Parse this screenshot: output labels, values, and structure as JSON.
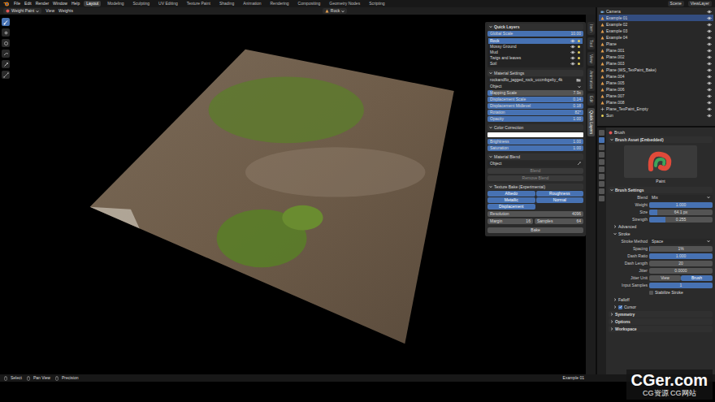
{
  "menubar": {
    "menus": [
      "File",
      "Edit",
      "Render",
      "Window",
      "Help"
    ],
    "workspaces": [
      {
        "label": "Layout",
        "selected": true
      },
      {
        "label": "Modeling",
        "selected": false
      },
      {
        "label": "Sculpting",
        "selected": false
      },
      {
        "label": "UV Editing",
        "selected": false
      },
      {
        "label": "Texture Paint",
        "selected": false
      },
      {
        "label": "Shading",
        "selected": false
      },
      {
        "label": "Animation",
        "selected": false
      },
      {
        "label": "Rendering",
        "selected": false
      },
      {
        "label": "Compositing",
        "selected": false
      },
      {
        "label": "Geometry Nodes",
        "selected": false
      },
      {
        "label": "Scripting",
        "selected": false
      }
    ],
    "scene": "Scene",
    "view_layer": "ViewLayer"
  },
  "header": {
    "mode": "Weight Paint",
    "menus": [
      "View",
      "Weights"
    ],
    "object": "Rock"
  },
  "toolbar": [
    {
      "kind": "draw",
      "selected": true
    },
    {
      "kind": "blur",
      "selected": false
    },
    {
      "kind": "average",
      "selected": false
    },
    {
      "kind": "smear",
      "selected": false
    },
    {
      "kind": "sample",
      "selected": false
    },
    {
      "kind": "gradient",
      "selected": false
    }
  ],
  "quick_layers": {
    "title": "Quick Layers",
    "global_scale": {
      "label": "Global Scale",
      "value": "10.00",
      "level": 1
    },
    "layers": [
      {
        "name": "Rock",
        "selected": true,
        "visible": true
      },
      {
        "name": "Mossy Ground",
        "selected": false,
        "visible": true
      },
      {
        "name": "Mud",
        "selected": false,
        "visible": true
      },
      {
        "name": "Twigs and leaves",
        "selected": false,
        "visible": true
      },
      {
        "name": "Soil",
        "selected": false,
        "visible": true
      }
    ],
    "material": {
      "title": "Material Settings",
      "texture": "rockandflo_jagged_rock_uccmbgelty_4k",
      "mapping": "Object",
      "sliders": [
        {
          "label": "Mapping Scale",
          "value": "7.9x",
          "level": 0.05
        },
        {
          "label": "Displacement Scale",
          "value": "0.14",
          "level": 1
        },
        {
          "label": "Displacement Midlevel",
          "value": "0.18",
          "level": 1
        },
        {
          "label": "Rotation",
          "value": "82°",
          "level": 1
        },
        {
          "label": "Opacity",
          "value": "1.00",
          "level": 1
        }
      ]
    },
    "color_correction": {
      "title": "Color Correction",
      "swatch": "#ffffff",
      "sliders": [
        {
          "label": "Brightness",
          "value": "1.00",
          "level": 1
        },
        {
          "label": "Saturation",
          "value": "1.00",
          "level": 1
        }
      ]
    },
    "blend": {
      "title": "Material Blend",
      "object": "Object",
      "buttons": [
        {
          "label": "Blend",
          "disabled": true
        },
        {
          "label": "Remove Blend",
          "disabled": true
        }
      ]
    },
    "bake": {
      "title": "Texture Bake (Experimental)",
      "maps": [
        {
          "label": "Albedo",
          "on": true
        },
        {
          "label": "Roughness",
          "on": true
        },
        {
          "label": "Metallic",
          "on": true
        },
        {
          "label": "Normal",
          "on": true
        },
        {
          "label": "Displacement",
          "on": true
        }
      ],
      "fields": [
        {
          "label": "Resolution",
          "value": "4096",
          "kind": "wide"
        },
        {
          "label": "Margin",
          "value": "16",
          "kind": "half"
        },
        {
          "label": "Samples",
          "value": "64",
          "kind": "half"
        }
      ],
      "button": "Bake"
    }
  },
  "side_tabs": [
    {
      "label": "Item",
      "selected": false
    },
    {
      "label": "Tool",
      "selected": false
    },
    {
      "label": "View",
      "selected": false
    },
    {
      "label": "Animation",
      "selected": false
    },
    {
      "label": "Edit",
      "selected": false
    },
    {
      "label": "Quick Layers",
      "selected": true
    }
  ],
  "outliner": {
    "items": [
      {
        "label": "Camera",
        "kind": "camera",
        "selected": false,
        "visible": true
      },
      {
        "label": "Example 01",
        "kind": "mesh",
        "selected": true,
        "visible": true
      },
      {
        "label": "Example 02",
        "kind": "mesh",
        "selected": false,
        "visible": true
      },
      {
        "label": "Example 03",
        "kind": "mesh",
        "selected": false,
        "visible": true
      },
      {
        "label": "Example 04",
        "kind": "mesh",
        "selected": false,
        "visible": true
      },
      {
        "label": "Plane",
        "kind": "mesh",
        "selected": false,
        "visible": true
      },
      {
        "label": "Plane.001",
        "kind": "mesh",
        "selected": false,
        "visible": true
      },
      {
        "label": "Plane.002",
        "kind": "mesh",
        "selected": false,
        "visible": true
      },
      {
        "label": "Plane.003",
        "kind": "mesh",
        "selected": false,
        "visible": true
      },
      {
        "label": "Plane (WS_TexPaint_Bake)",
        "kind": "mesh",
        "selected": false,
        "visible": true
      },
      {
        "label": "Plane.004",
        "kind": "mesh",
        "selected": false,
        "visible": true
      },
      {
        "label": "Plane.005",
        "kind": "mesh",
        "selected": false,
        "visible": true
      },
      {
        "label": "Plane.006",
        "kind": "mesh",
        "selected": false,
        "visible": true
      },
      {
        "label": "Plane.007",
        "kind": "mesh",
        "selected": false,
        "visible": true
      },
      {
        "label": "Plane.008",
        "kind": "mesh",
        "selected": false,
        "visible": true
      },
      {
        "label": "Plane_TexPaint_Empty",
        "kind": "empty",
        "selected": false,
        "visible": true
      },
      {
        "label": "Sun",
        "kind": "light",
        "selected": false,
        "visible": true
      }
    ]
  },
  "properties": {
    "title": "Brush",
    "tabs": [
      {
        "selected": false
      },
      {
        "selected": true
      },
      {
        "selected": false
      },
      {
        "selected": false
      },
      {
        "selected": false
      },
      {
        "selected": false
      },
      {
        "selected": false
      },
      {
        "selected": false
      },
      {
        "selected": false
      },
      {
        "selected": false
      }
    ],
    "rows": [
      {
        "kind": "panel",
        "label": "Brush Asset (Embedded)",
        "expanded": true
      },
      {
        "kind": "preview",
        "label": "Paint"
      },
      {
        "kind": "panel",
        "label": "Brush Settings",
        "expanded": true
      },
      {
        "kind": "dropdown",
        "label": "Blend",
        "value": "Mix"
      },
      {
        "kind": "slider",
        "label": "Weight",
        "value": "1.000",
        "level": 1
      },
      {
        "kind": "slider",
        "label": "Size",
        "value": "64.1 px",
        "level": 0.13
      },
      {
        "kind": "slider",
        "label": "Strength",
        "value": "0.255",
        "level": 0.255
      },
      {
        "kind": "subpanel",
        "label": "Advanced",
        "expanded": false
      },
      {
        "kind": "subpanel",
        "label": "Stroke",
        "expanded": true
      },
      {
        "kind": "dropdown",
        "label": "Stroke Method",
        "value": "Space"
      },
      {
        "kind": "slider",
        "label": "Spacing",
        "value": "1%",
        "level": 0.01
      },
      {
        "kind": "slider",
        "label": "Dash Ratio",
        "value": "1.000",
        "level": 1
      },
      {
        "kind": "slider",
        "label": "Dash Length",
        "value": "20",
        "level": 0
      },
      {
        "kind": "slider",
        "label": "Jitter",
        "value": "0.0000",
        "level": 0
      },
      {
        "kind": "choice",
        "label": "Jitter Unit",
        "options": [
          {
            "label": "View",
            "selected": false
          },
          {
            "label": "Brush",
            "selected": true
          }
        ]
      },
      {
        "kind": "slider",
        "label": "Input Samples",
        "value": "1",
        "level": 1
      },
      {
        "kind": "checkbox",
        "label": "Stabilize Stroke",
        "checked": false
      },
      {
        "kind": "subpanel",
        "label": "Falloff",
        "expanded": false
      },
      {
        "kind": "subcheck",
        "label": "Cursor",
        "expanded": false,
        "checked": true
      },
      {
        "kind": "panel",
        "label": "Symmetry",
        "expanded": false
      },
      {
        "kind": "panel",
        "label": "Options",
        "expanded": false
      },
      {
        "kind": "panel",
        "label": "Workspace",
        "expanded": false
      }
    ]
  },
  "status_bar": {
    "hints": [
      "Select",
      "Pan View",
      "Precision"
    ],
    "info": "Example 01"
  },
  "watermark": {
    "logo": "CGer.com",
    "tagline": "CG资源 CG网站"
  }
}
